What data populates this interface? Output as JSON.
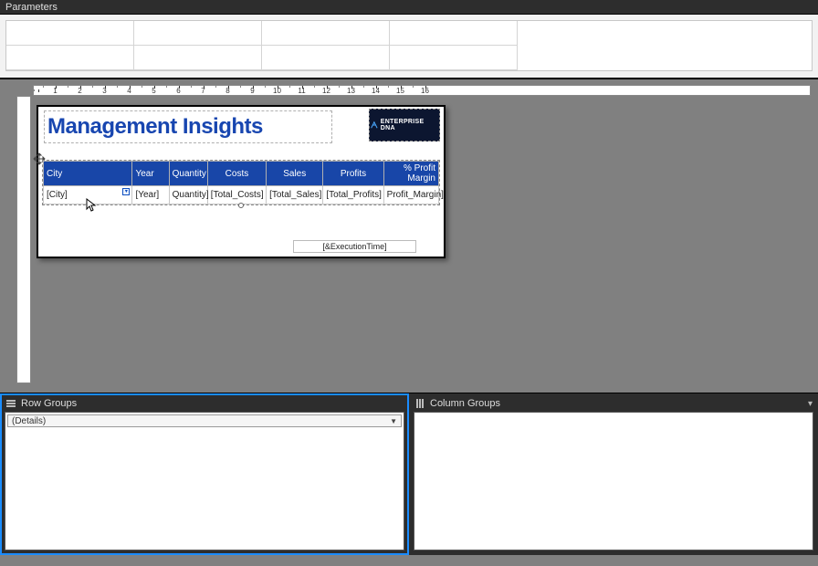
{
  "parameters_label": "Parameters",
  "ruler": [
    "1",
    "2",
    "3",
    "4",
    "5",
    "6",
    "7",
    "8",
    "9",
    "10",
    "11",
    "12",
    "13",
    "14",
    "15",
    "16"
  ],
  "report": {
    "title": "Management Insights",
    "logo_text": "ENTERPRISE DNA",
    "columns": {
      "city": "City",
      "year": "Year",
      "quantity": "Quantity",
      "costs": "Costs",
      "sales": "Sales",
      "profits": "Profits",
      "profit_margin": "% Profit Margin"
    },
    "fields": {
      "city": "[City]",
      "year": "[Year]",
      "quantity": "Quantity]",
      "costs": "[Total_Costs]",
      "sales": "[Total_Sales]",
      "profits": "[Total_Profits]",
      "profit_margin": "Profit_Margin]"
    },
    "exec_time": "[&ExecutionTime]"
  },
  "groups": {
    "row_label": "Row Groups",
    "col_label": "Column Groups",
    "row_items": [
      "(Details)"
    ]
  }
}
